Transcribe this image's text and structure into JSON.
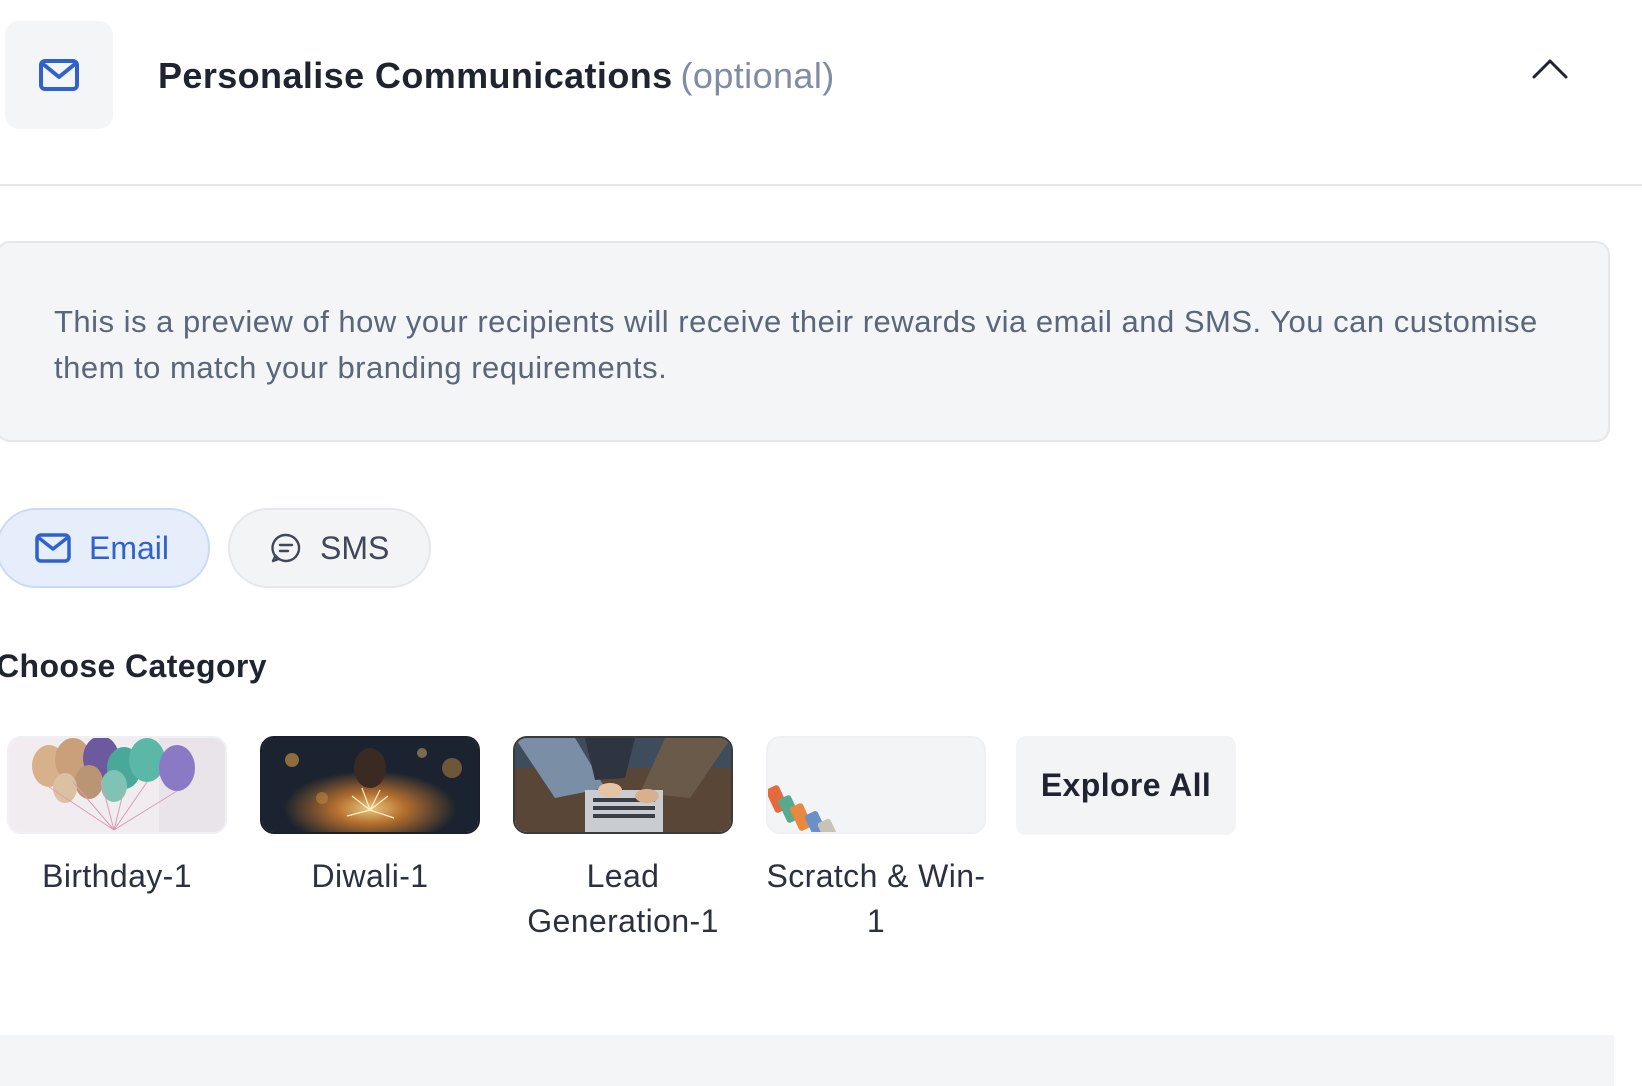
{
  "header": {
    "title": "Personalise Communications",
    "optional_label": "(optional)",
    "icon": "mail-icon",
    "collapse_icon": "chevron-up-icon"
  },
  "info": {
    "text": "This is a preview of how your recipients will receive their rewards via email and SMS. You can customise them to match your branding requirements."
  },
  "channels": {
    "email_label": "Email",
    "sms_label": "SMS",
    "selected": "Email"
  },
  "category": {
    "heading": "Choose Category",
    "items": [
      {
        "name": "Birthday-1",
        "image": "balloons-image"
      },
      {
        "name": "Diwali-1",
        "image": "sparkler-image"
      },
      {
        "name": "Lead Generation-1",
        "image": "laptop-hands-image"
      },
      {
        "name": "Scratch & Win-1",
        "image": "scratch-cards-image"
      }
    ],
    "explore_label": "Explore All"
  },
  "colors": {
    "accent": "#2f62cc",
    "accent_bg": "#e6eefb",
    "muted_text": "#7f8ca3",
    "panel_bg": "#f4f5f7"
  }
}
